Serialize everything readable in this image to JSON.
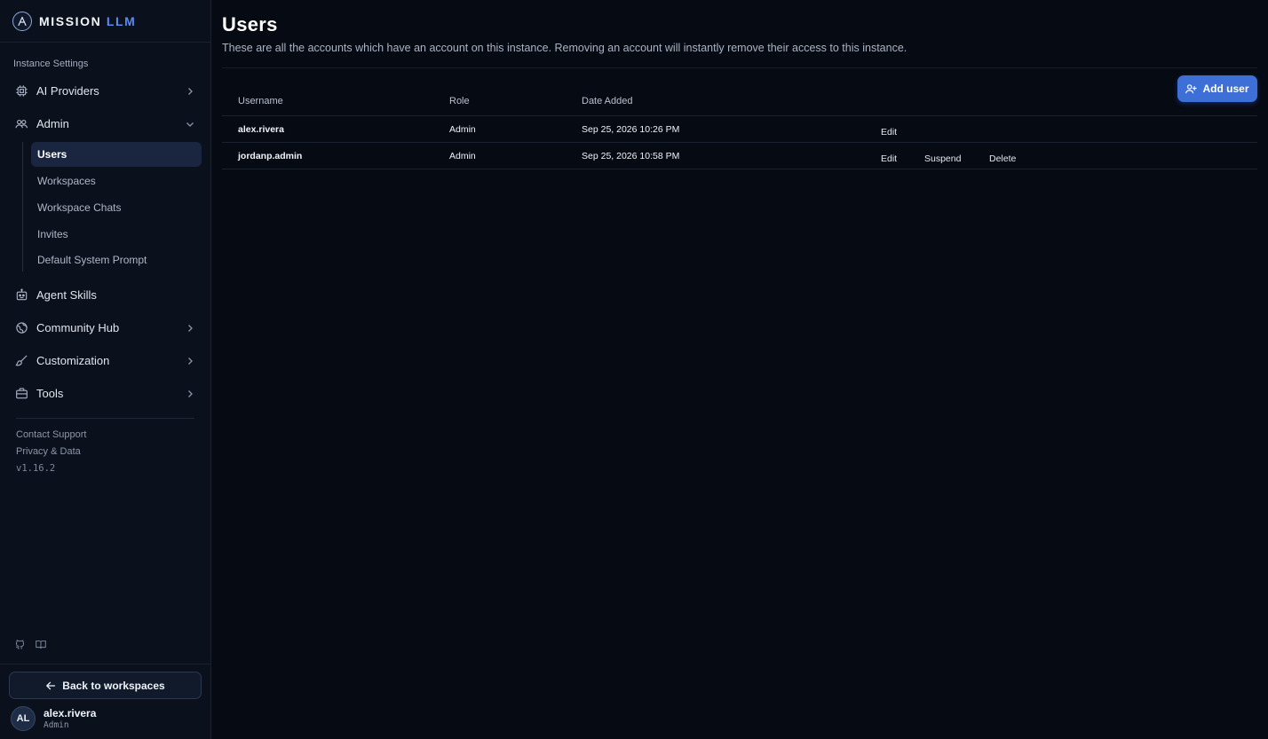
{
  "brand": {
    "name_main": "MISSION",
    "name_accent": "LLM",
    "logo_icon": "mission-logo-icon"
  },
  "sidebar": {
    "section_label": "Instance Settings",
    "nav": [
      {
        "label": "AI Providers",
        "icon": "chip-icon",
        "expandable": true,
        "expanded": false
      },
      {
        "label": "Admin",
        "icon": "users-icon",
        "expandable": true,
        "expanded": true
      },
      {
        "label": "Agent Skills",
        "icon": "robot-icon",
        "expandable": false
      },
      {
        "label": "Community Hub",
        "icon": "globe-icon",
        "expandable": true,
        "expanded": false
      },
      {
        "label": "Customization",
        "icon": "brush-icon",
        "expandable": true,
        "expanded": false
      },
      {
        "label": "Tools",
        "icon": "briefcase-icon",
        "expandable": true,
        "expanded": false
      }
    ],
    "admin_subitems": [
      {
        "label": "Users",
        "active": true
      },
      {
        "label": "Workspaces",
        "active": false
      },
      {
        "label": "Workspace Chats",
        "active": false
      },
      {
        "label": "Invites",
        "active": false
      },
      {
        "label": "Default System Prompt",
        "active": false
      }
    ],
    "footer_links": [
      "Contact Support",
      "Privacy & Data"
    ],
    "version": "v1.16.2",
    "back_button": "Back to workspaces",
    "user": {
      "initials": "AL",
      "name": "alex.rivera",
      "role": "Admin"
    }
  },
  "main": {
    "title": "Users",
    "description": "These are all the accounts which have an account on this instance. Removing an account will instantly remove their access to this instance.",
    "add_button": "Add user",
    "columns": [
      "Username",
      "Role",
      "Date Added"
    ],
    "rows": [
      {
        "username": "alex.rivera",
        "role": "Admin",
        "date_added": "Sep 25, 2026 10:26 PM",
        "actions": [
          "Edit"
        ]
      },
      {
        "username": "jordanp.admin",
        "role": "Admin",
        "date_added": "Sep 25, 2026 10:58 PM",
        "actions": [
          "Edit",
          "Suspend",
          "Delete"
        ]
      }
    ]
  },
  "colors": {
    "background": "#060a13",
    "sidebar": "#0b111c",
    "accent": "#3e6fd6",
    "active_item": "#1a2640"
  }
}
